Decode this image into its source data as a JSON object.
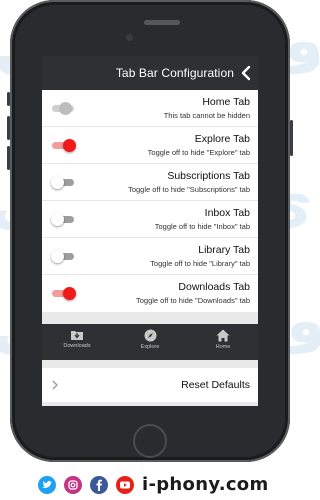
{
  "nav": {
    "title": "Tab Bar Configuration",
    "back_icon": "chevron-left-icon"
  },
  "settings": [
    {
      "label": "Home Tab",
      "description": "This tab cannot be hidden",
      "state": "disabled"
    },
    {
      "label": "Explore Tab",
      "description": "Toggle off to hide \"Explore\" tab",
      "state": "on"
    },
    {
      "label": "Subscriptions Tab",
      "description": "Toggle off to hide \"Subscriptions\" tab",
      "state": "off"
    },
    {
      "label": "Inbox Tab",
      "description": "Toggle off to hide \"Inbox\" tab",
      "state": "off"
    },
    {
      "label": "Library Tab",
      "description": "Toggle off to hide \"Library\" tab",
      "state": "off"
    },
    {
      "label": "Downloads Tab",
      "description": "Toggle off to hide \"Downloads\" tab",
      "state": "on"
    }
  ],
  "tabbar": [
    {
      "label": "Downloads",
      "icon": "downloads-icon"
    },
    {
      "label": "Explore",
      "icon": "compass-icon"
    },
    {
      "label": "Home",
      "icon": "home-icon"
    }
  ],
  "reset": {
    "label": "Reset Defaults",
    "icon": "chevron-right-icon"
  },
  "footer": {
    "brand": "i-phony.com",
    "icons": [
      "twitter-icon",
      "instagram-icon",
      "facebook-icon",
      "youtube-icon"
    ]
  },
  "colors": {
    "toggle_on": "#f01a1a",
    "toggle_on_track": "#f59b9b",
    "bar": "#2f3033"
  }
}
